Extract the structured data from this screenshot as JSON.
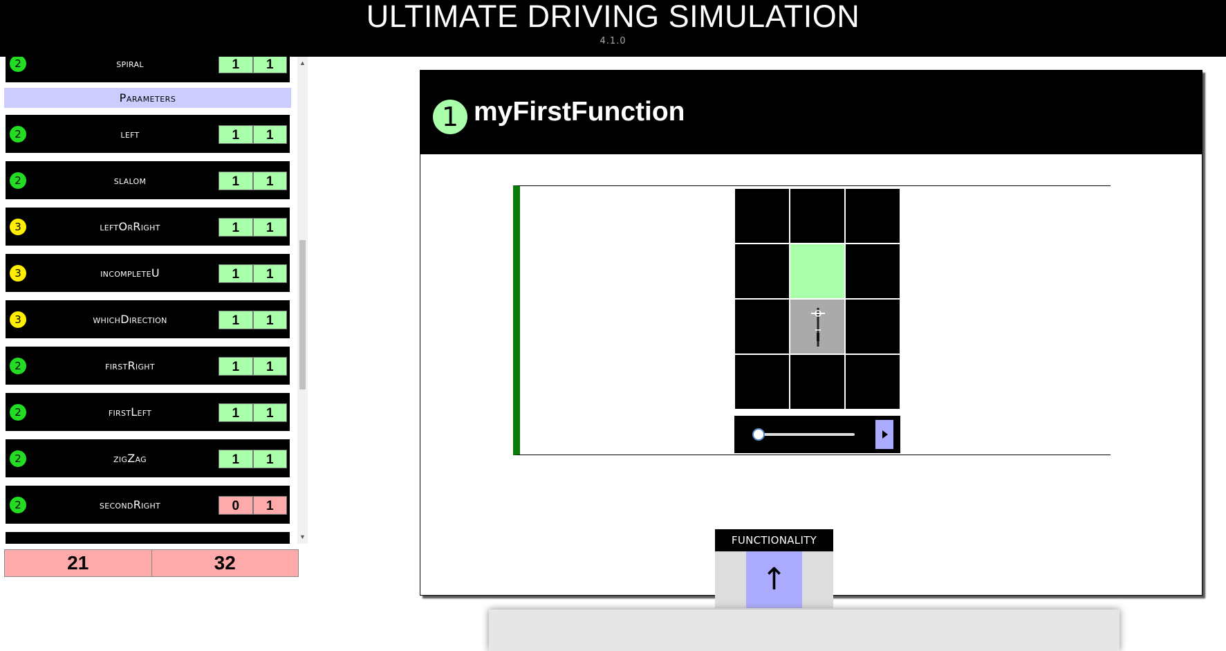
{
  "app": {
    "title": "ULTIMATE DRIVING SIMULATION",
    "version": "4.1.0"
  },
  "sidebar": {
    "top_level": {
      "badge": "2",
      "name": "spiral",
      "scores": [
        "1",
        "1"
      ],
      "badge_color": "#22dd22"
    },
    "section_header": "Parameters",
    "levels": [
      {
        "badge": "2",
        "name": "left",
        "scores": [
          "1",
          "1"
        ],
        "badge_color": "#22dd22"
      },
      {
        "badge": "2",
        "name": "slalom",
        "scores": [
          "1",
          "1"
        ],
        "badge_color": "#22dd22"
      },
      {
        "badge": "3",
        "name": "leftOrRight",
        "scores": [
          "1",
          "1"
        ],
        "badge_color": "#ffee00"
      },
      {
        "badge": "3",
        "name": "incompleteU",
        "scores": [
          "1",
          "1"
        ],
        "badge_color": "#ffee00"
      },
      {
        "badge": "3",
        "name": "whichDirection",
        "scores": [
          "1",
          "1"
        ],
        "badge_color": "#ffee00"
      },
      {
        "badge": "2",
        "name": "firstRight",
        "scores": [
          "1",
          "1"
        ],
        "badge_color": "#22dd22"
      },
      {
        "badge": "2",
        "name": "firstLeft",
        "scores": [
          "1",
          "1"
        ],
        "badge_color": "#22dd22"
      },
      {
        "badge": "2",
        "name": "zigZag",
        "scores": [
          "1",
          "1"
        ],
        "badge_color": "#22dd22"
      },
      {
        "badge": "2",
        "name": "secondRight",
        "scores": [
          "0",
          "1"
        ],
        "badge_color": "#22dd22"
      }
    ],
    "totals": [
      "21",
      "32"
    ]
  },
  "function_card": {
    "badge": "1",
    "title": "myFirstFunction"
  },
  "simulation": {
    "grid_rows": 4,
    "grid_cols": 3,
    "goal_cell": [
      1,
      1
    ],
    "start_cell": [
      2,
      1
    ],
    "slider_position": 0
  },
  "functionality": {
    "label": "FUNCTIONALITY",
    "commands": [
      {
        "icon": "up-arrow-icon",
        "glyph": "↑"
      }
    ]
  },
  "colors": {
    "header_bg": "#000000",
    "ok": "#aaffaa",
    "bad": "#ffaaaa",
    "section": "#ccccff",
    "progress_bar": "#0a7a0a",
    "play_button": "#aaaaff"
  }
}
